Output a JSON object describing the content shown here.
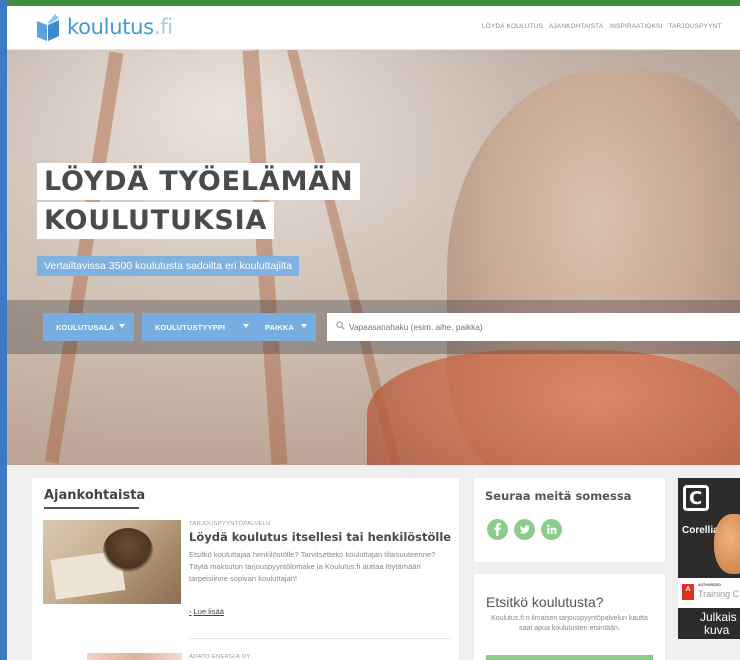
{
  "header": {
    "logo_text": "koulutus",
    "logo_suffix": ".fi",
    "nav": [
      "LÖYDÄ KOULUTUS",
      "AJANKOHTAISTA",
      "INSPIRAATIOKSI",
      "TARJOUSPYYNT"
    ]
  },
  "hero": {
    "title_line1": "LÖYDÄ TYÖELÄMÄN",
    "title_line2": "KOULUTUKSIA",
    "subtitle": "Vertailtavissa 3500 koulutusta sadoilta eri kouluttajilta"
  },
  "search": {
    "dropdowns": [
      "KOULUTUSALA",
      "KOULUTUSTYYPPI",
      "PAIKKA"
    ],
    "placeholder": "Vapaasanahaku (esim. aihe, paikka)"
  },
  "news": {
    "title": "Ajankohtaista",
    "article": {
      "kicker": "TARJOUSPYYNTÖPALVELU",
      "heading": "Löydä koulutus itsellesi tai henkilöstölle",
      "body": "Etsitkö kouluttajaa henkilöstölle? Tarvitsetteko kouluttajan tilaisuuteenne? Täytä maksuton tarjouspyyntölomake ja Koulutus.fi auttaa löytämään tarpeisiinne sopivan kouluttajan!",
      "read_more": "Lue lisää"
    },
    "article2_kicker": "ADATO ENERGIA OY"
  },
  "social": {
    "title": "Seuraa meitä somessa",
    "icons": [
      "facebook-icon",
      "twitter-icon",
      "linkedin-icon"
    ]
  },
  "find": {
    "title": "Etsitkö koulutusta?",
    "text": "Koulutus.fi:n ilmaisen tarjouspyyntöpalvelun kautta saat apua koulutusten etsintään."
  },
  "ad": {
    "logo_letter": "C",
    "brand": "Corellia",
    "adobe_mark": "A",
    "authorized": "AUTHORIZED",
    "training": "Training C",
    "line1": "Julkais",
    "line2": "kuva"
  },
  "colors": {
    "accent_blue": "#77ade0",
    "green": "#8ccc8a",
    "top_strip": "#3e8e41",
    "left_strip": "#3c7bc4"
  }
}
